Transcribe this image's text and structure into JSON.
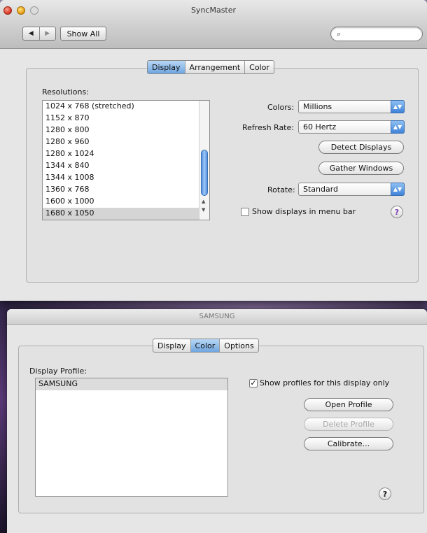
{
  "window1": {
    "title": "SyncMaster",
    "toolbar": {
      "back_label": "◀",
      "forward_label": "▶",
      "show_all_label": "Show All",
      "search_value": "",
      "search_icon": "⌕"
    },
    "tabs": [
      "Display",
      "Arrangement",
      "Color"
    ],
    "selected_tab": "Display",
    "resolutions_label": "Resolutions:",
    "resolutions": [
      "1024 x 768 (stretched)",
      "1152 x 870",
      "1280 x 800",
      "1280 x 960",
      "1280 x 1024",
      "1344 x 840",
      "1344 x 1008",
      "1360 x 768",
      "1600 x 1000",
      "1680 x 1050"
    ],
    "selected_resolution": "1680 x 1050",
    "colors_label": "Colors:",
    "colors_value": "Millions",
    "refresh_label": "Refresh Rate:",
    "refresh_value": "60 Hertz",
    "detect_displays_label": "Detect Displays",
    "gather_windows_label": "Gather Windows",
    "rotate_label": "Rotate:",
    "rotate_value": "Standard",
    "show_in_menubar_label": "Show displays in menu bar",
    "show_in_menubar_checked": false,
    "help_label": "?"
  },
  "window2": {
    "title": "SAMSUNG",
    "tabs": [
      "Display",
      "Color",
      "Options"
    ],
    "selected_tab": "Color",
    "profile_label": "Display Profile:",
    "profiles": [
      "SAMSUNG"
    ],
    "show_profiles_label": "Show profiles for this display only",
    "show_profiles_checked": true,
    "open_profile_label": "Open Profile",
    "delete_profile_label": "Delete Profile",
    "calibrate_label": "Calibrate...",
    "help_label": "?"
  },
  "colors": {
    "selection_blue": "#6fa6e0",
    "help_purple": "#7a3db0"
  }
}
